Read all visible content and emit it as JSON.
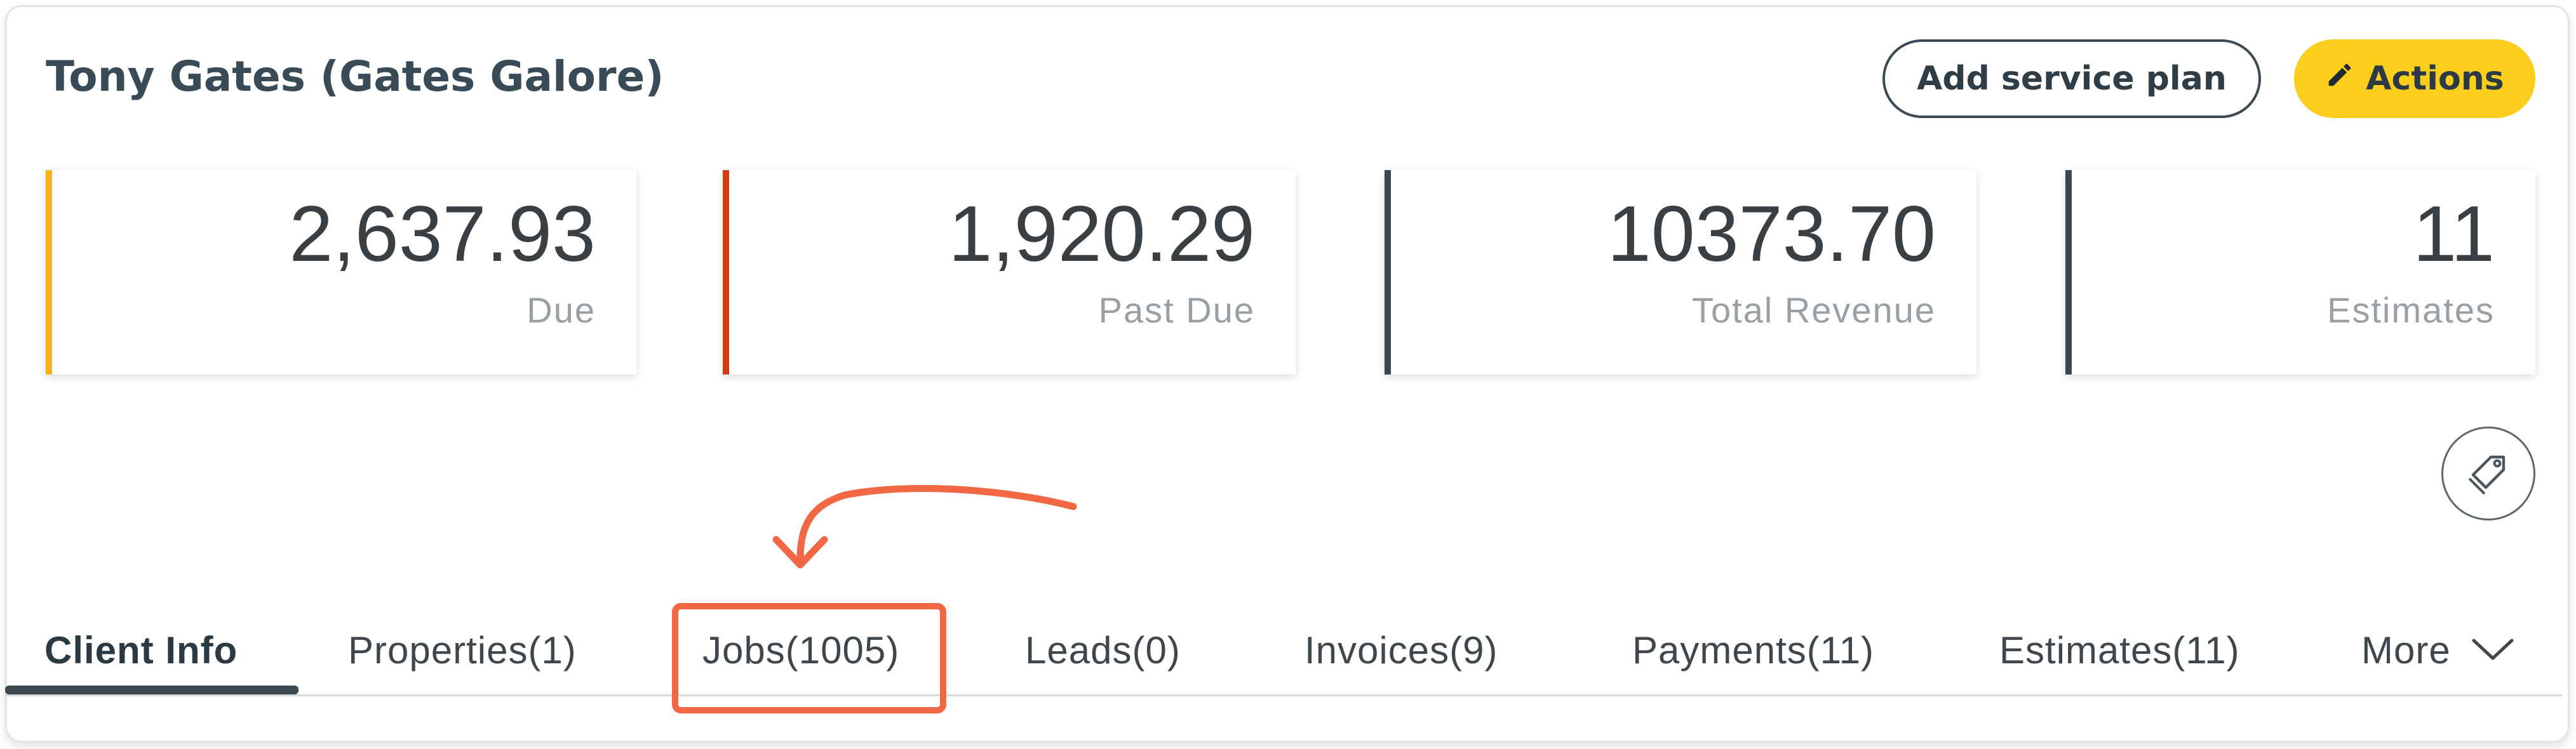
{
  "header": {
    "client_name": "Tony Gates (Gates Galore)",
    "add_service_plan_label": "Add service plan",
    "actions_label": "Actions"
  },
  "stats": [
    {
      "value": "2,637.93",
      "label": "Due",
      "accent": "#f7b21b"
    },
    {
      "value": "1,920.29",
      "label": "Past Due",
      "accent": "#d23d10"
    },
    {
      "value": "10373.70",
      "label": "Total Revenue",
      "accent": "#3a4751"
    },
    {
      "value": "11",
      "label": "Estimates",
      "accent": "#3a4751"
    }
  ],
  "tabs": [
    {
      "label": "Client Info",
      "active": true
    },
    {
      "label": "Properties(1)"
    },
    {
      "label": "Jobs(1005)"
    },
    {
      "label": "Leads(0)"
    },
    {
      "label": "Invoices(9)"
    },
    {
      "label": "Payments(11)"
    },
    {
      "label": "Estimates(11)"
    },
    {
      "label": "More"
    }
  ],
  "icons": {
    "actions": "pencil-icon",
    "tag": "tag-icon",
    "more": "chevron-down-icon"
  },
  "colors": {
    "actions_bg": "#fbce1e",
    "annotation": "#f26744",
    "text_dark": "#394b57"
  }
}
